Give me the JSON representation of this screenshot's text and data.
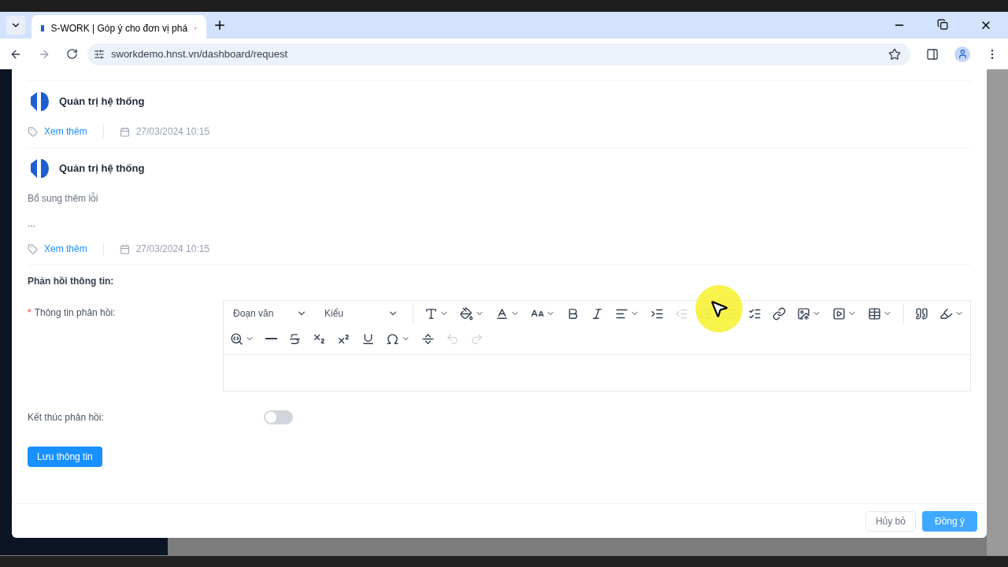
{
  "browser": {
    "tab_title": "S-WORK | Góp ý cho đơn vị phá",
    "url": "sworkdemo.hnst.vn/dashboard/request"
  },
  "comments": [
    {
      "author": "Quản trị hệ thống",
      "link": "Xem thêm",
      "date": "27/03/2024 10:15"
    },
    {
      "author": "Quản trị hệ thống",
      "lines": [
        "Bổ sung thêm lỗi",
        "..."
      ],
      "link": "Xem thêm",
      "date": "27/03/2024 10:15"
    }
  ],
  "section_title": "Phản hồi thông tin:",
  "editor": {
    "label": "Thông tin phản hồi:",
    "required_mark": "*",
    "rows": [
      [
        {
          "kind": "select",
          "text": "Đoạn văn"
        },
        {
          "kind": "select",
          "text": "Kiểu"
        },
        {
          "kind": "sep"
        },
        {
          "kind": "fontsize",
          "disabled": false
        },
        {
          "kind": "fontbg",
          "disabled": false
        },
        {
          "kind": "fontcolor",
          "disabled": false
        },
        {
          "kind": "lineheight",
          "disabled": false
        },
        {
          "kind": "bold",
          "disabled": false
        },
        {
          "kind": "italic",
          "disabled": false
        },
        {
          "kind": "align",
          "disabled": false
        },
        {
          "kind": "indent",
          "disabled": false
        },
        {
          "kind": "outdent",
          "disabled": true
        },
        {
          "kind": "numbered",
          "disabled": true
        },
        {
          "kind": "bulleted",
          "disabled": true
        },
        {
          "kind": "todo",
          "disabled": false
        },
        {
          "kind": "link",
          "disabled": false
        },
        {
          "kind": "image",
          "disabled": false
        },
        {
          "kind": "media",
          "disabled": false
        },
        {
          "kind": "table",
          "disabled": false
        },
        {
          "kind": "sep"
        },
        {
          "kind": "quote",
          "disabled": false
        },
        {
          "kind": "highlight",
          "disabled": false
        }
      ],
      [
        {
          "kind": "find",
          "disabled": false
        },
        {
          "kind": "hr",
          "disabled": false
        },
        {
          "kind": "strike",
          "disabled": false
        },
        {
          "kind": "sub",
          "disabled": false
        },
        {
          "kind": "sup",
          "disabled": false
        },
        {
          "kind": "underline",
          "disabled": false
        },
        {
          "kind": "omega",
          "disabled": false
        },
        {
          "kind": "pagebreak",
          "disabled": false
        },
        {
          "kind": "undo",
          "disabled": true
        },
        {
          "kind": "redo",
          "disabled": true
        }
      ]
    ]
  },
  "end_feedback": {
    "label": "Kết thúc phản hồi:",
    "on": false
  },
  "save_button": "Lưu thông tin",
  "footer": {
    "cancel": "Hủy bỏ",
    "ok": "Đồng ý"
  }
}
